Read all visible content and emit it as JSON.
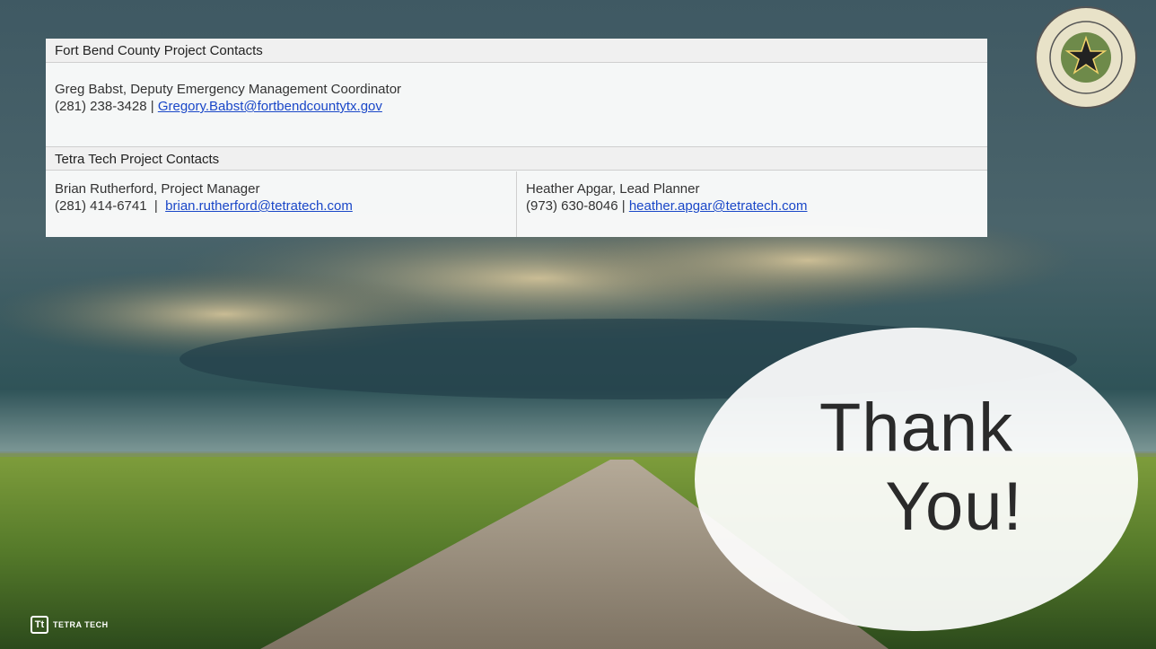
{
  "fort_bend": {
    "heading": "Fort Bend County Project Contacts",
    "name_line": "Greg Babst, Deputy Emergency Management Coordinator",
    "phone": "(281) 238-3428",
    "sep": " | ",
    "email": "Gregory.Babst@fortbendcountytx.gov"
  },
  "tetra": {
    "heading": "Tetra Tech Project Contacts",
    "left": {
      "name_line": "Brian Rutherford, Project Manager",
      "phone": "(281) 414-6741",
      "sep": "  |  ",
      "email": "brian.rutherford@tetratech.com"
    },
    "right": {
      "name_line": "Heather Apgar, Lead Planner",
      "phone": "(973) 630-8046",
      "sep": " | ",
      "email": "heather.apgar@tetratech.com"
    }
  },
  "closing": {
    "line1": "Thank",
    "line2": "You!"
  },
  "branding": {
    "logo_mark": "Tt",
    "logo_text": "TETRA TECH",
    "seal": "seal-icon"
  },
  "colors": {
    "link": "#1a47c8",
    "heading_bg": "#f0f0f0"
  }
}
